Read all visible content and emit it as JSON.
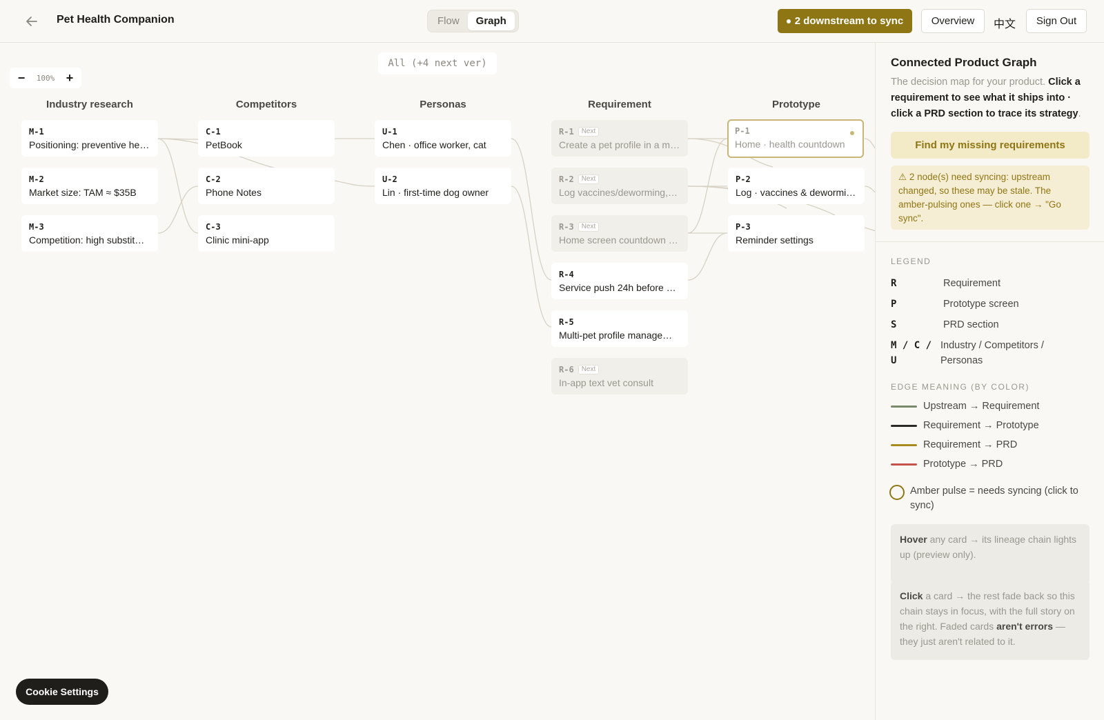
{
  "header": {
    "app_title": "Pet Health Companion",
    "tabs": [
      "Flow",
      "Graph"
    ],
    "active_tab": "Graph",
    "sync_label": "2 downstream to sync",
    "overview_label": "Overview",
    "lang_label": "中文",
    "signout_label": "Sign Out"
  },
  "canvas": {
    "filter_label": "All (+4 next ver)",
    "zoom_label": "100%",
    "zoom_out": "−",
    "zoom_in": "+",
    "columns": [
      "Industry research",
      "Competitors",
      "Personas",
      "Requirement",
      "Prototype"
    ],
    "cards": {
      "m1": {
        "id": "M-1",
        "text": "Positioning: preventive he…"
      },
      "m2": {
        "id": "M-2",
        "text": "Market size: TAM ≈ $35B"
      },
      "m3": {
        "id": "M-3",
        "text": "Competition: high substit…"
      },
      "c1": {
        "id": "C-1",
        "text": "PetBook"
      },
      "c2": {
        "id": "C-2",
        "text": "Phone Notes"
      },
      "c3": {
        "id": "C-3",
        "text": "Clinic mini-app"
      },
      "u1": {
        "id": "U-1",
        "text": "Chen · office worker, cat"
      },
      "u2": {
        "id": "U-2",
        "text": "Lin · first-time dog owner"
      },
      "r1": {
        "id": "R-1",
        "badge": "Next",
        "text": "Create a pet profile in a m…"
      },
      "r2": {
        "id": "R-2",
        "badge": "Next",
        "text": "Log vaccines/deworming,…"
      },
      "r3": {
        "id": "R-3",
        "badge": "Next",
        "text": "Home screen countdown …"
      },
      "r4": {
        "id": "R-4",
        "text": "Service push 24h before …"
      },
      "r5": {
        "id": "R-5",
        "text": "Multi-pet profile manage…"
      },
      "r6": {
        "id": "R-6",
        "badge": "Next",
        "text": "In-app text vet consult"
      },
      "p1": {
        "id": "P-1",
        "text": "Home · health countdown"
      },
      "p2": {
        "id": "P-2",
        "text": "Log · vaccines & dewormi…"
      },
      "p3": {
        "id": "P-3",
        "text": "Reminder settings"
      }
    },
    "cookie_label": "Cookie Settings"
  },
  "panel": {
    "title": "Connected Product Graph",
    "desc_intro": "The decision map for your product. ",
    "desc_bold": "Click a requirement to see what it ships into · click a PRD section to trace its strategy",
    "desc_end": ".",
    "find_label": "Find my missing requirements",
    "warning": "⚠ 2 node(s) need syncing: upstream changed, so these may be stale. The amber-pulsing ones — click one → \"Go sync\".",
    "legend_label": "LEGEND",
    "legend": [
      {
        "key": "R",
        "desc": "Requirement"
      },
      {
        "key": "P",
        "desc": "Prototype screen"
      },
      {
        "key": "S",
        "desc": "PRD section"
      },
      {
        "key": "M / C / U",
        "desc": "Industry / Competitors / Personas"
      }
    ],
    "edge_label": "EDGE MEANING (BY COLOR)",
    "edges": [
      {
        "label": "Upstream → Requirement",
        "color": "#7b8a6a"
      },
      {
        "label": "Requirement → Prototype",
        "color": "#2a2926"
      },
      {
        "label": "Requirement → PRD",
        "color": "#a88a1e"
      },
      {
        "label": "Prototype → PRD",
        "color": "#c5524a"
      }
    ],
    "pulse_label": "Amber pulse = needs syncing (click to sync)",
    "tip1_bold": "Hover",
    "tip1_text": " any card → its lineage chain lights up (preview only).",
    "tip2_bold1": "Click",
    "tip2_text1": " a card → the rest fade back so this chain stays in focus, with the full story on the right. Faded cards ",
    "tip2_bold2": "aren't errors",
    "tip2_text2": " — they just aren't related to it."
  }
}
